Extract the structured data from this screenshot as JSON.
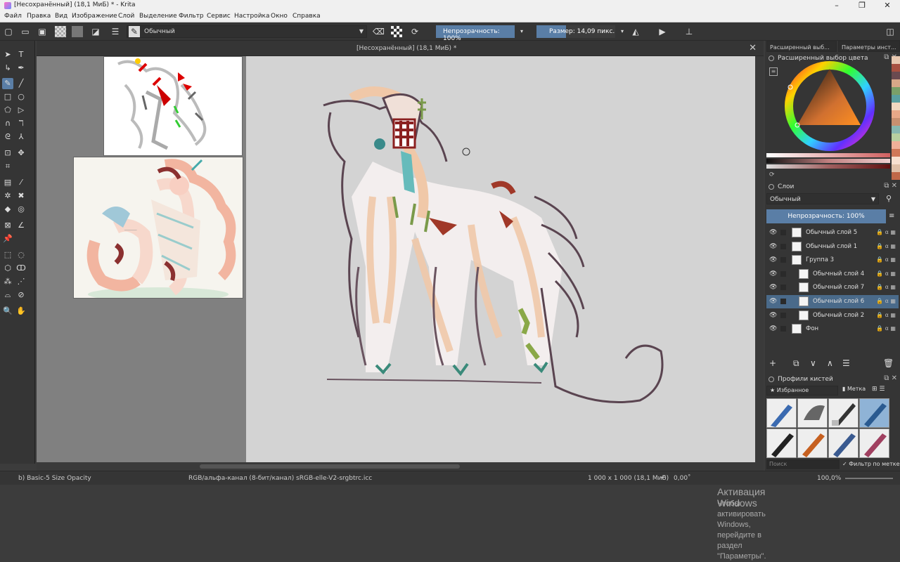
{
  "window": {
    "title": "[Несохранённый]  (18,1 МиБ) * - Krita"
  },
  "menu": [
    "Файл",
    "Правка",
    "Вид",
    "Изображение",
    "Слой",
    "Выделение",
    "Фильтр",
    "Сервис",
    "Настройка",
    "Окно",
    "Справка"
  ],
  "toolbar": {
    "blend_mode": "Обычный",
    "opacity_label": "Непрозрачность: 100%",
    "size_label": "Размер: 14,09 пикс."
  },
  "document": {
    "tab_title": "[Несохранённый]  (18,1 МиБ) *"
  },
  "dock": {
    "tabs": [
      "Расширенный выб...",
      "Параметры инст..."
    ],
    "color_panel_title": "Расширенный выбор цвета",
    "layers_panel_title": "Слои",
    "layer_blend_mode": "Обычный",
    "layer_opacity": "Непрозрачность:  100%",
    "layers": [
      {
        "name": "Обычный слой 5",
        "indent": 0,
        "selected": false
      },
      {
        "name": "Обычный слой 1",
        "indent": 0,
        "selected": false
      },
      {
        "name": "Группа 3",
        "indent": 0,
        "selected": false
      },
      {
        "name": "Обычный слой 4",
        "indent": 1,
        "selected": false
      },
      {
        "name": "Обычный слой 7",
        "indent": 1,
        "selected": false
      },
      {
        "name": "Обычный слой 6",
        "indent": 1,
        "selected": true
      },
      {
        "name": "Обычный слой 2",
        "indent": 1,
        "selected": false
      },
      {
        "name": "Фон",
        "indent": 0,
        "selected": false
      }
    ],
    "brush_panel_title": "Профили кистей",
    "brush_tag": "Избранное",
    "brush_tag_button": "Метка",
    "search_placeholder": "Поиск",
    "filter_label": "Фильтр по метке"
  },
  "statusbar": {
    "brush_name": "b) Basic-5 Size Opacity",
    "color_profile": "RGB/альфа-канал (8-бит/канал)  sRGB-elle-V2-srgbtrc.icc",
    "image_size": "1 000 x 1 000 (18,1 МиБ)",
    "rotation": "0,00˚",
    "zoom": "100,0%"
  },
  "watermark": {
    "line1": "Активация Windows",
    "line2": "Чтобы активировать Windows, перейдите в раздел",
    "line3": "\"Параметры\"."
  },
  "colors": {
    "accent": "#5a7ea6",
    "canvas": "#d3d3d3",
    "panel": "#353535"
  }
}
